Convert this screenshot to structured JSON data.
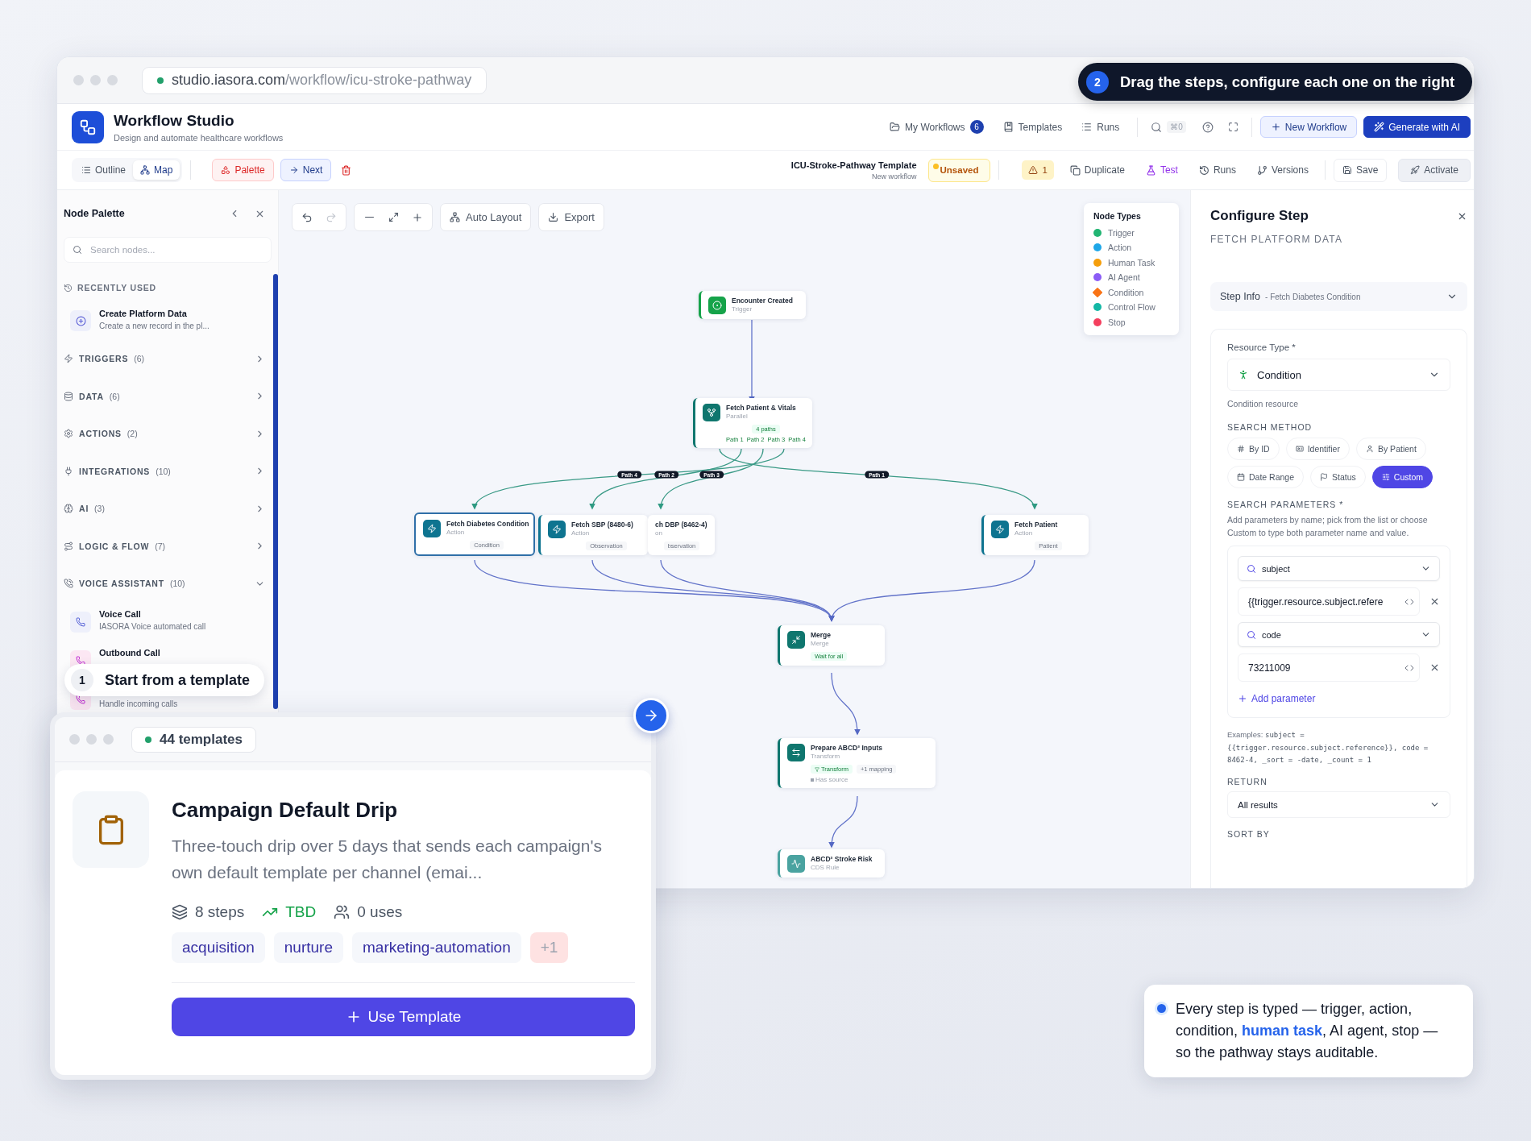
{
  "browser": {
    "url_host": "studio.iasora.com",
    "url_path": "/workflow/icu-stroke-pathway"
  },
  "tip": {
    "number": "2",
    "text": "Drag the steps, configure each one on the right"
  },
  "app": {
    "title": "Workflow Studio",
    "subtitle": "Design and automate healthcare workflows",
    "nav": [
      {
        "label": "My Workflows",
        "badge": "6"
      },
      {
        "label": "Templates"
      },
      {
        "label": "Runs"
      }
    ],
    "shortcut": "⌘0",
    "new_button": "New Workflow",
    "ai_button": "Generate with AI"
  },
  "toolbar": {
    "views": [
      {
        "label": "Outline",
        "selected": false
      },
      {
        "label": "Map",
        "selected": true
      }
    ],
    "palette": "Palette",
    "next": "Next",
    "workflow_name": "ICU-Stroke-Pathway Template",
    "workflow_sub": "New workflow",
    "status": "Unsaved",
    "warnings": "1",
    "actions": [
      {
        "label": "Duplicate",
        "kind": "plain"
      },
      {
        "label": "Test",
        "kind": "accent"
      },
      {
        "label": "Runs",
        "kind": "plain"
      },
      {
        "label": "Versions",
        "kind": "plain"
      }
    ],
    "save": "Save",
    "activate": "Activate"
  },
  "palette": {
    "title": "Node Palette",
    "search_placeholder": "Search nodes...",
    "recent_label": "RECENTLY USED",
    "recent": [
      {
        "title": "Create Platform Data",
        "desc": "Create a new record in the pl..."
      }
    ],
    "categories": [
      {
        "label": "TRIGGERS",
        "count": "(6)",
        "expanded": false
      },
      {
        "label": "DATA",
        "count": "(6)",
        "expanded": false
      },
      {
        "label": "ACTIONS",
        "count": "(2)",
        "expanded": false
      },
      {
        "label": "INTEGRATIONS",
        "count": "(10)",
        "expanded": false
      },
      {
        "label": "AI",
        "count": "(3)",
        "expanded": false
      },
      {
        "label": "LOGIC & FLOW",
        "count": "(7)",
        "expanded": false
      },
      {
        "label": "VOICE ASSISTANT",
        "count": "(10)",
        "expanded": true,
        "items": [
          {
            "title": "Voice Call",
            "desc": "IASORA Voice automated call"
          },
          {
            "title": "Outbound Call"
          },
          {
            "desc": "Handle incoming calls"
          }
        ]
      }
    ]
  },
  "tour_step": {
    "number": "1",
    "text": "Start from a template"
  },
  "canvas": {
    "auto_layout": "Auto Layout",
    "export": "Export",
    "legend": {
      "title": "Node Types",
      "items": [
        {
          "label": "Trigger",
          "color": "#22b573",
          "kind": "dot"
        },
        {
          "label": "Action",
          "color": "#1ea7e8",
          "kind": "dot"
        },
        {
          "label": "Human Task",
          "color": "#f59e0b",
          "kind": "dot"
        },
        {
          "label": "AI Agent",
          "color": "#8b5cf6",
          "kind": "dot"
        },
        {
          "label": "Condition",
          "color": "#f97316",
          "kind": "diamond"
        },
        {
          "label": "Control Flow",
          "color": "#14b8a6",
          "kind": "dot"
        },
        {
          "label": "Stop",
          "color": "#f43f5e",
          "kind": "dot"
        }
      ]
    },
    "nodes": [
      {
        "kind": "trigger",
        "title": "Encounter Created",
        "subtitle": "Trigger",
        "selected": false
      },
      {
        "kind": "parallel",
        "title": "Fetch Patient & Vitals",
        "subtitle": "Parallel",
        "tags": [
          {
            "label": "4 paths",
            "kind": "green"
          }
        ],
        "ports": [
          "Path 1",
          "Path 2",
          "Path 3",
          "Path 4"
        ],
        "selected": false
      },
      {
        "kind": "action",
        "title": "Fetch Diabetes Condition",
        "subtitle": "Action",
        "tags": [
          {
            "label": "Condition",
            "kind": "plain"
          }
        ],
        "selected": true
      },
      {
        "kind": "action",
        "title": "Fetch SBP (8480-6)",
        "subtitle": "Action",
        "tags": [
          {
            "label": "Observation",
            "kind": "plain"
          }
        ],
        "selected": false
      },
      {
        "kind": "partial",
        "title": "ch DBP (8462-4)",
        "subtitle": "on",
        "tags": [
          {
            "label": "bservation",
            "kind": "plain"
          }
        ],
        "selected": false
      },
      {
        "kind": "action",
        "title": "Fetch Patient",
        "subtitle": "Action",
        "tags": [
          {
            "label": "Patient",
            "kind": "plain"
          }
        ],
        "selected": false
      },
      {
        "kind": "merge",
        "title": "Merge",
        "subtitle": "Merge",
        "tags": [
          {
            "label": "Wait for all",
            "kind": "green"
          }
        ],
        "selected": false
      },
      {
        "kind": "transform",
        "title": "Prepare ABCD² Inputs",
        "subtitle": "Transform",
        "tags": [
          {
            "label": "Transform",
            "kind": "filter"
          },
          {
            "label": "+1 mapping",
            "kind": "plain"
          }
        ],
        "note": "Has source",
        "selected": false
      },
      {
        "kind": "rule",
        "title": "ABCD² Stroke Risk",
        "subtitle": "CDS Rule",
        "selected": false
      }
    ],
    "path_labels": [
      "Path 4",
      "Path 2",
      "Path 3",
      "Path 1"
    ]
  },
  "config": {
    "title": "Configure Step",
    "subtitle": "FETCH PLATFORM DATA",
    "step_info": "Step Info",
    "step_info_detail": "- Fetch Diabetes Condition",
    "resource_label": "Resource Type *",
    "resource_value": "Condition",
    "resource_hint": "Condition resource",
    "method_label": "SEARCH METHOD",
    "methods": [
      {
        "label": "By ID",
        "selected": false
      },
      {
        "label": "Identifier",
        "selected": false
      },
      {
        "label": "By Patient",
        "selected": false
      },
      {
        "label": "Date Range",
        "selected": false
      },
      {
        "label": "Status",
        "selected": false
      },
      {
        "label": "Custom",
        "selected": true
      }
    ],
    "params_label": "SEARCH PARAMETERS *",
    "params_hint": "Add parameters by name; pick from the list or choose Custom to type both parameter name and value.",
    "params": [
      {
        "name": "subject",
        "value": "{{trigger.resource.subject.refere"
      },
      {
        "name": "code",
        "value": "73211009"
      }
    ],
    "add_param": "Add parameter",
    "examples_label": "Examples:",
    "examples_code": "subject = {{trigger.resource.subject.reference}}, code = 8462-4, _sort = -date, _count = 1",
    "return_label": "RETURN",
    "return_value": "All results",
    "sort_label": "SORT BY"
  },
  "template_window": {
    "count": "44 templates",
    "title": "Campaign Default Drip",
    "description": "Three-touch drip over 5 days that sends each campaign's own default template per channel (emai...",
    "stats": [
      {
        "label": "8 steps",
        "kind": "plain"
      },
      {
        "label": "TBD",
        "kind": "positive"
      },
      {
        "label": "0 uses",
        "kind": "plain"
      }
    ],
    "tags": [
      {
        "label": "acquisition",
        "kind": "tag"
      },
      {
        "label": "nurture",
        "kind": "tag"
      },
      {
        "label": "marketing-automation",
        "kind": "tag"
      },
      {
        "label": "+1",
        "kind": "more"
      }
    ],
    "button": "Use Template"
  },
  "callout": {
    "before": "Every step is typed — trigger, action, condition, ",
    "link": "human task",
    "after": ", AI agent, stop — so the pathway stays auditable."
  }
}
